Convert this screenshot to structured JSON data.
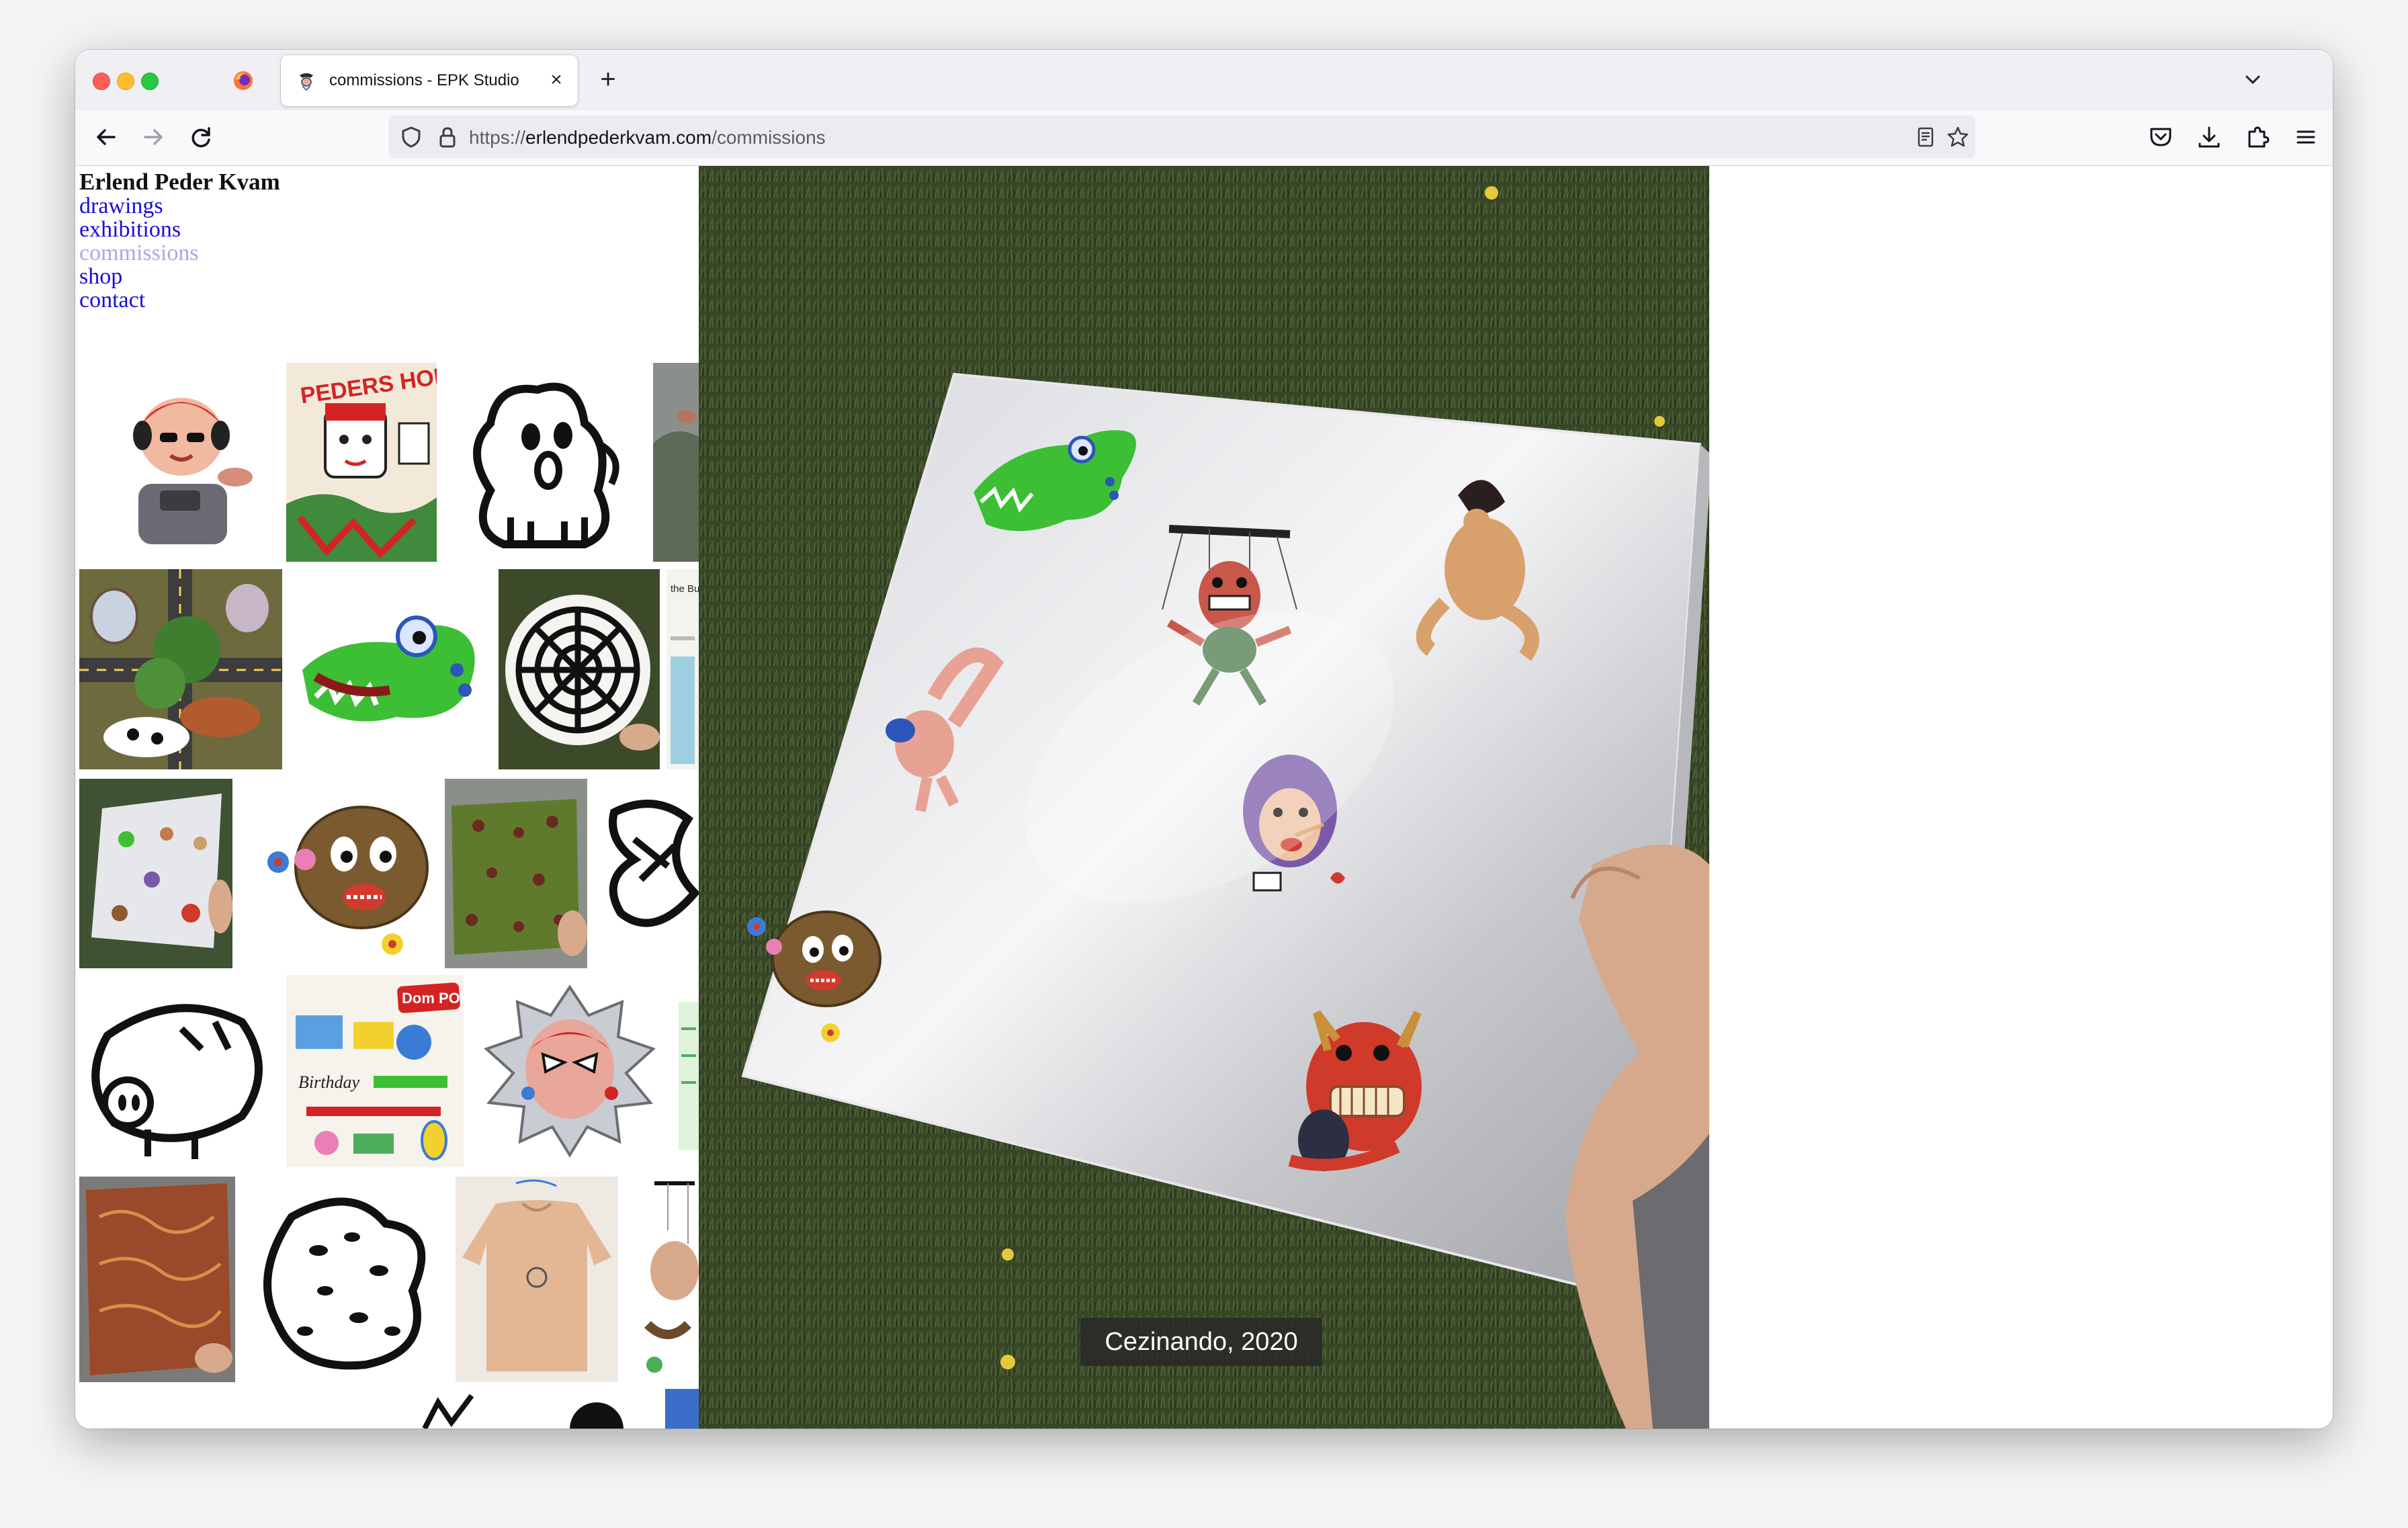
{
  "tab": {
    "title": "commissions - EPK Studio"
  },
  "nav": {
    "url_prefix": "https://",
    "url_host": "erlendpederkvam.com",
    "url_path": "/commissions"
  },
  "site": {
    "title": "Erlend Peder Kvam",
    "menu": [
      {
        "label": "drawings"
      },
      {
        "label": "exhibitions"
      },
      {
        "label": "commissions",
        "active": true
      },
      {
        "label": "shop"
      },
      {
        "label": "contact"
      }
    ]
  },
  "viewer": {
    "caption": "Cezinando, 2020"
  },
  "thumbnails": {
    "poster_text": "PEDERS HODE",
    "dompoko_text": "Dom POKO",
    "birthday_text": "Birthday",
    "article_snippet": "the Bub"
  },
  "colors": {
    "link": "#1a0dd9",
    "link_active": "#a9a8e6",
    "tab_strip": "#f0f0f4",
    "grass": "#3b4a2a"
  }
}
